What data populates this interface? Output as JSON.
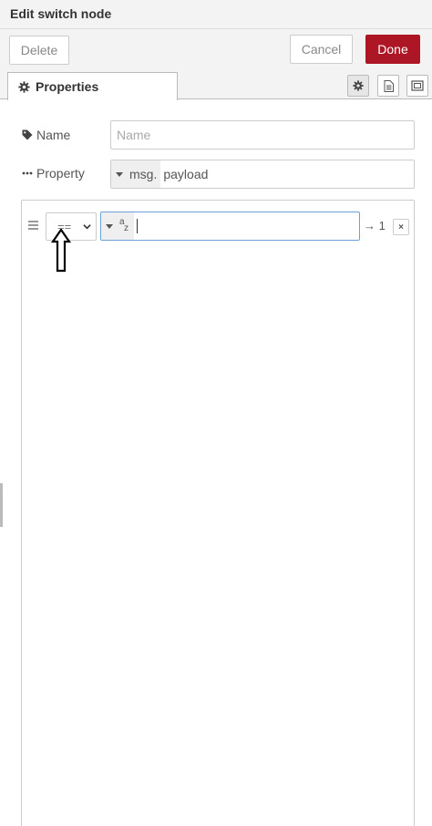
{
  "header": {
    "title": "Edit switch node"
  },
  "toolbar": {
    "delete_label": "Delete",
    "cancel_label": "Cancel",
    "done_label": "Done"
  },
  "tabs": [
    {
      "label": "Properties",
      "icon": "gear-icon"
    }
  ],
  "tab_icons": [
    "gear-icon",
    "document-icon",
    "frame-icon"
  ],
  "form": {
    "name": {
      "label": "Name",
      "placeholder": "Name",
      "value": ""
    },
    "property": {
      "label": "Property",
      "type": "msg.",
      "value": "payload"
    }
  },
  "rule": {
    "operator": "==",
    "value_type": "az",
    "value_type_a": "a",
    "value_type_z": "z",
    "value": "",
    "output": "→ 1",
    "remove": "×"
  },
  "colors": {
    "done_bg": "#ad1625",
    "focus_border": "#6aa1d9",
    "header_bg": "#f3f3f3"
  }
}
